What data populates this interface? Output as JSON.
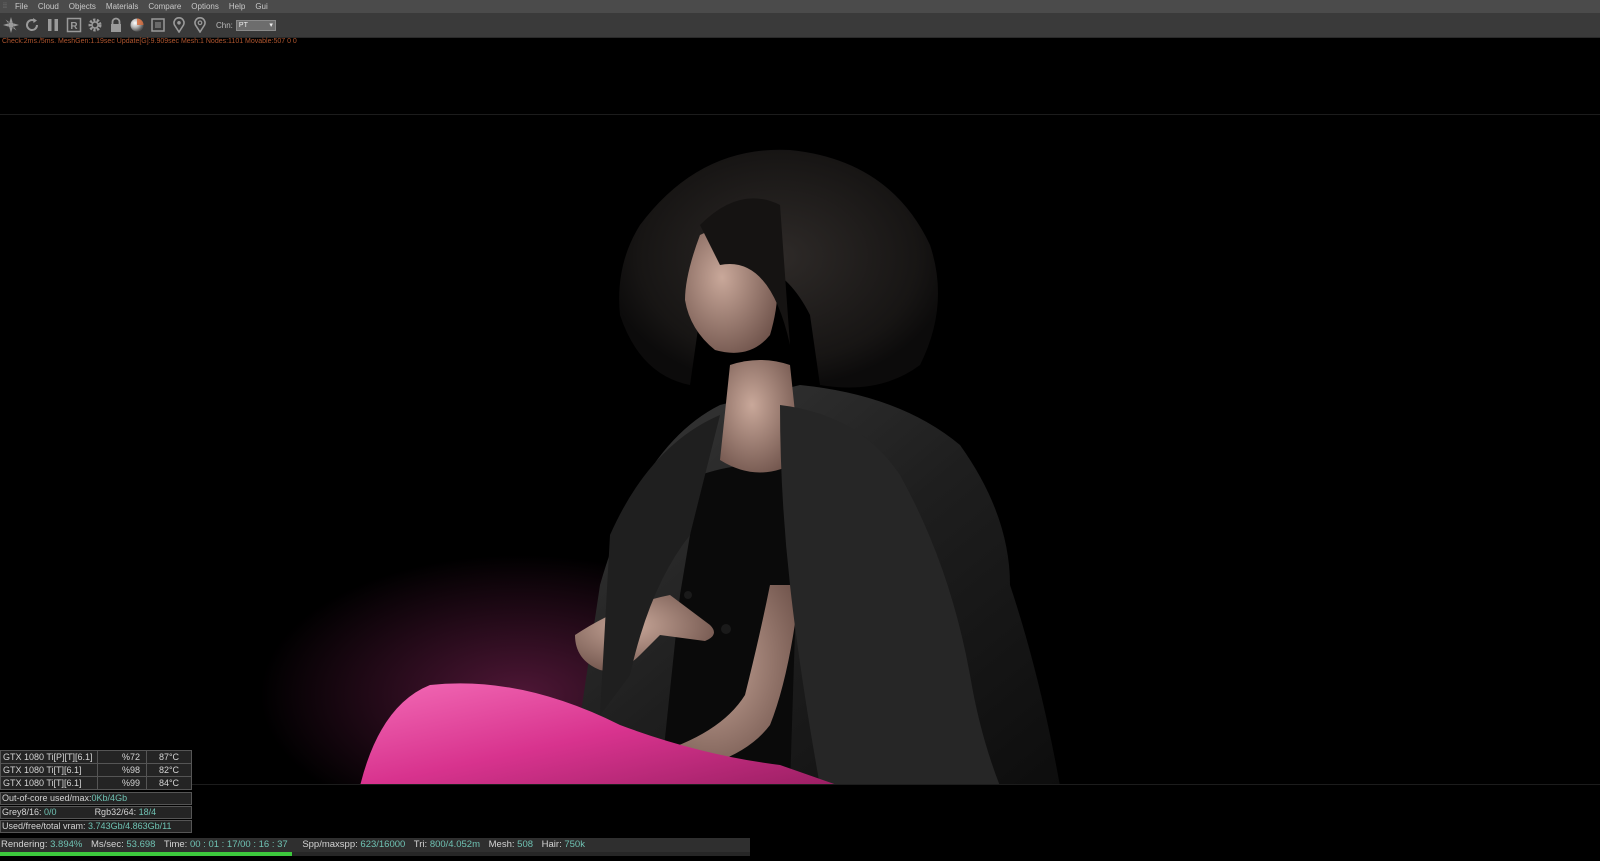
{
  "menubar": {
    "items": [
      "File",
      "Cloud",
      "Objects",
      "Materials",
      "Compare",
      "Options",
      "Help",
      "Gui"
    ]
  },
  "toolbar": {
    "icons": [
      "send-scene-icon",
      "restart-icon",
      "pause-icon",
      "region-r-icon",
      "settings-gear-icon",
      "lock-icon",
      "material-ball-icon",
      "clay-icon",
      "pin-icon",
      "pin-2-icon"
    ],
    "channel_label": "Chn:",
    "channel_value": "PT"
  },
  "status_line": "Check:2ms./5ms. MeshGen:1.19sec Update[G]:9.909sec Mesh:1 Nodes:1101 Movable:507  0 0",
  "gpus": [
    {
      "name": "GTX 1080 Ti[P][T][6.1]",
      "util": "%72",
      "temp": "87°C"
    },
    {
      "name": "GTX 1080 Ti[T][6.1]",
      "util": "%98",
      "temp": "82°C"
    },
    {
      "name": "GTX 1080 Ti[T][6.1]",
      "util": "%99",
      "temp": "84°C"
    }
  ],
  "memory": {
    "outofcore_label": "Out-of-core used/max:",
    "outofcore_value": "0Kb/4Gb",
    "grey_label": "Grey8/16:",
    "grey_value": "0/0",
    "rgb_label": "Rgb32/64:",
    "rgb_value": "18/4",
    "vram_label": "Used/free/total vram:",
    "vram_value": "3.743Gb/4.863Gb/11"
  },
  "render_status": {
    "rendering_label": "Rendering:",
    "rendering_value": "3.894%",
    "mssec_label": "Ms/sec:",
    "mssec_value": "53.698",
    "time_label": "Time:",
    "time_value": "00 : 01 : 17/00 : 16 : 37",
    "spp_label": "Spp/maxspp:",
    "spp_value": "623/16000",
    "tri_label": "Tri:",
    "tri_value": "800/4.052m",
    "mesh_label": "Mesh:",
    "mesh_value": "508",
    "hair_label": "Hair:",
    "hair_value": "750k",
    "progress": 0.03894
  },
  "colors": {
    "status_text": "#b0562f",
    "value_text": "#6fc2b3",
    "progress": "#3cc83c",
    "leggings": "#e0409a"
  }
}
